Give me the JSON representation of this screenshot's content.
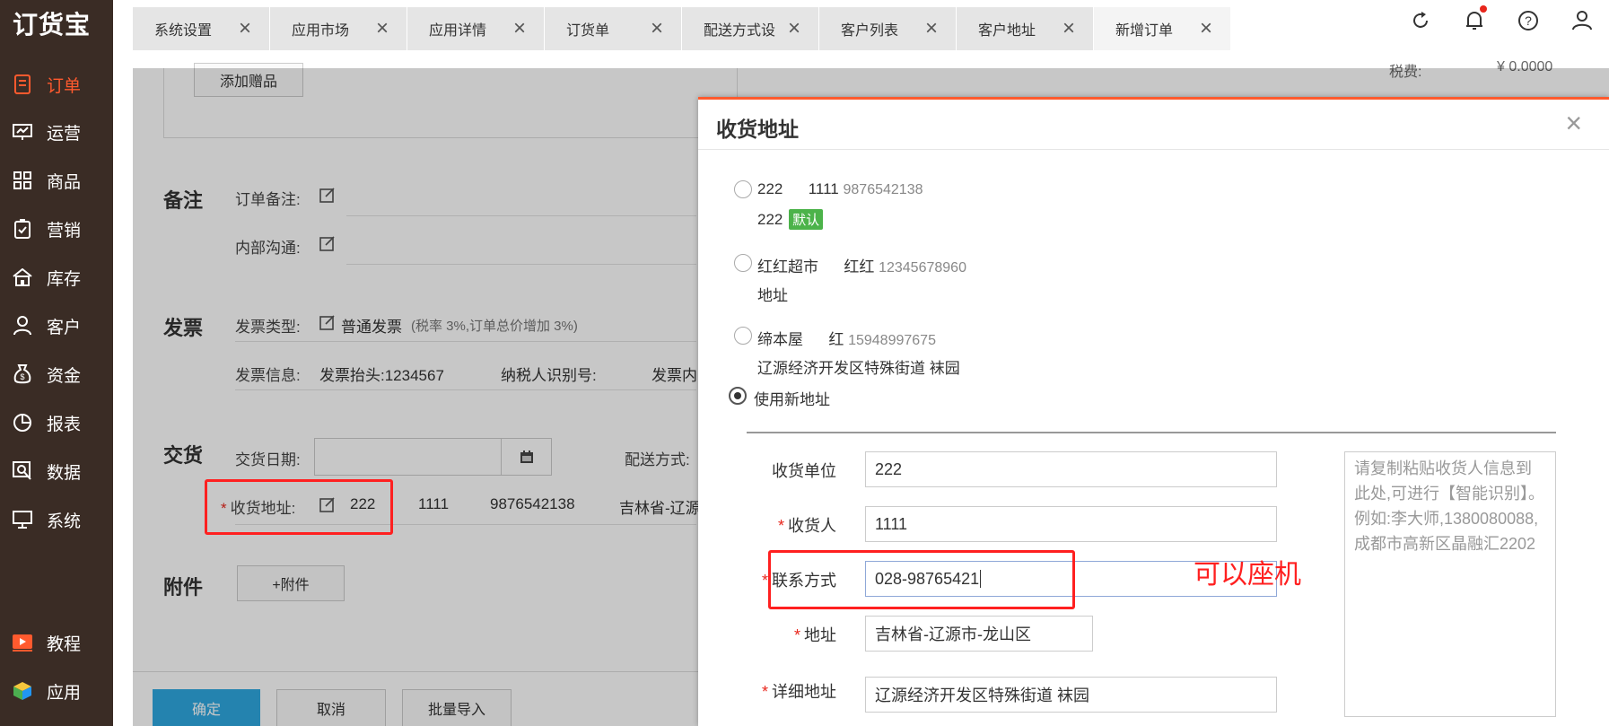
{
  "sidebar": {
    "logo": "订货宝",
    "items": [
      {
        "label": "订单",
        "icon": "order-icon",
        "active": true
      },
      {
        "label": "运营",
        "icon": "operation-icon"
      },
      {
        "label": "商品",
        "icon": "goods-icon"
      },
      {
        "label": "营销",
        "icon": "marketing-icon"
      },
      {
        "label": "库存",
        "icon": "inventory-icon"
      },
      {
        "label": "客户",
        "icon": "customer-icon"
      },
      {
        "label": "资金",
        "icon": "funds-icon"
      },
      {
        "label": "报表",
        "icon": "report-icon"
      },
      {
        "label": "数据",
        "icon": "data-icon"
      },
      {
        "label": "系统",
        "icon": "system-icon"
      },
      {
        "label": "教程",
        "icon": "tutorial-icon"
      },
      {
        "label": "应用",
        "icon": "apps-icon"
      }
    ]
  },
  "tabs": [
    {
      "label": "系统设置"
    },
    {
      "label": "应用市场"
    },
    {
      "label": "应用详情"
    },
    {
      "label": "订货单"
    },
    {
      "label": "配送方式设"
    },
    {
      "label": "客户列表"
    },
    {
      "label": "客户地址"
    },
    {
      "label": "新增订单",
      "active": true
    }
  ],
  "page": {
    "add_gift": "添加赠品",
    "tax_label": "税费:",
    "tax_value": "¥ 0.0000",
    "remark_title": "备注",
    "order_remark_label": "订单备注:",
    "internal_label": "内部沟通:",
    "invoice_title": "发票",
    "invoice_type_label": "发票类型:",
    "invoice_type_value": "普通发票",
    "invoice_type_note": "(税率 3%,订单总价增加 3%)",
    "invoice_info_label": "发票信息:",
    "invoice_head": "发票抬头:1234567",
    "taxpayer_id": "纳税人识别号:",
    "invoice_content": "发票内",
    "delivery_title": "交货",
    "delivery_date_label": "交货日期:",
    "shipping_label": "配送方式:",
    "address_label": "收货地址:",
    "address_name": "222",
    "address_person": "1111",
    "address_phone": "9876542138",
    "address_region": "吉林省-辽源",
    "attachment_title": "附件",
    "attachment_btn": "+附件",
    "confirm": "确定",
    "cancel": "取消",
    "batch_import": "批量导入"
  },
  "modal": {
    "title": "收货地址",
    "addresses": [
      {
        "name": "222",
        "person": "1111",
        "phone": "9876542138",
        "detail": "222",
        "badge": "默认"
      },
      {
        "name": "红红超市",
        "person": "红红",
        "phone": "12345678960",
        "detail": "地址"
      },
      {
        "name": "缔本屋",
        "person": "红",
        "phone": "15948997675",
        "detail": "辽源经济开发区特殊街道 袜园"
      }
    ],
    "use_new": "使用新地址",
    "form": {
      "unit_label": "收货单位",
      "unit_value": "222",
      "receiver_label": "收货人",
      "receiver_value": "1111",
      "contact_label": "联系方式",
      "contact_value": "028-98765421",
      "region_label": "地址",
      "region_value": "吉林省-辽源市-龙山区",
      "detail_label": "详细地址",
      "detail_value": "辽源经济开发区特殊街道 袜园"
    },
    "paste_placeholder": "请复制粘贴收货人信息到此处,可进行【智能识别】。例如:李大师,1380080088,成都市高新区晶融汇2202",
    "annotation": "可以座机"
  }
}
